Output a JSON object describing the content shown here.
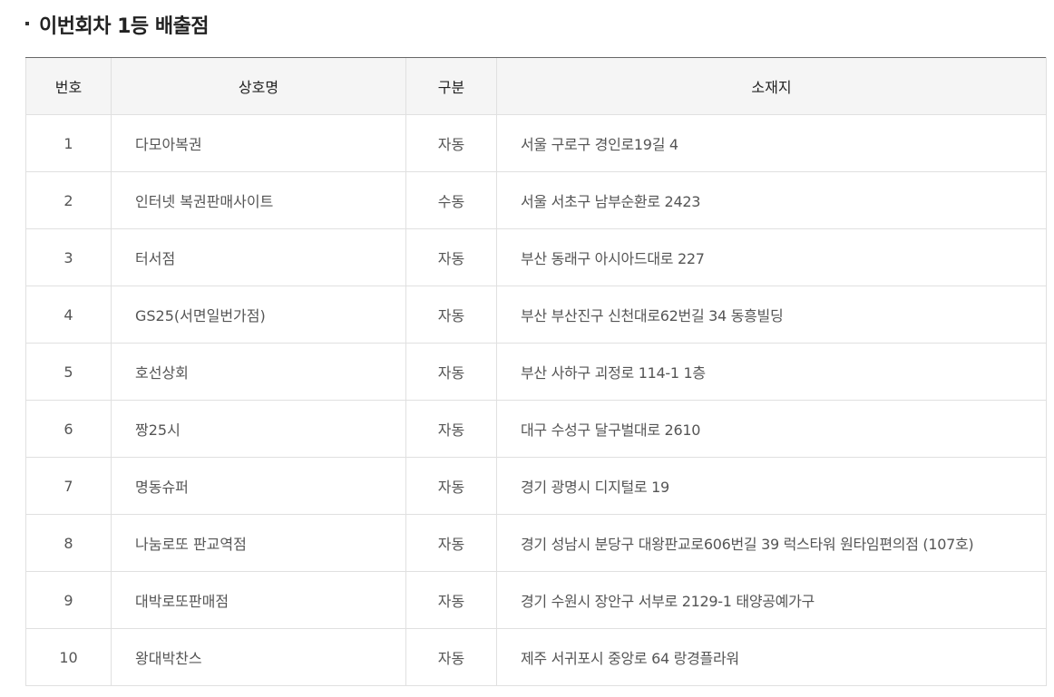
{
  "section": {
    "title": "이번회차 1등 배출점"
  },
  "table": {
    "headers": {
      "no": "번호",
      "name": "상호명",
      "type": "구분",
      "address": "소재지"
    },
    "rows": [
      {
        "no": "1",
        "name": "다모아복권",
        "type": "자동",
        "address": "서울 구로구 경인로19길 4"
      },
      {
        "no": "2",
        "name": "인터넷 복권판매사이트",
        "type": "수동",
        "address": "서울 서초구 남부순환로 2423"
      },
      {
        "no": "3",
        "name": "터서점",
        "type": "자동",
        "address": "부산 동래구 아시아드대로 227"
      },
      {
        "no": "4",
        "name": "GS25(서면일번가점)",
        "type": "자동",
        "address": "부산 부산진구 신천대로62번길 34 동흥빌딩"
      },
      {
        "no": "5",
        "name": "호선상회",
        "type": "자동",
        "address": "부산 사하구 괴정로 114-1 1층"
      },
      {
        "no": "6",
        "name": "짱25시",
        "type": "자동",
        "address": "대구 수성구 달구벌대로 2610"
      },
      {
        "no": "7",
        "name": "명동슈퍼",
        "type": "자동",
        "address": "경기 광명시 디지털로 19"
      },
      {
        "no": "8",
        "name": "나눔로또 판교역점",
        "type": "자동",
        "address": "경기 성남시 분당구 대왕판교로606번길 39 럭스타워 원타임편의점 (107호)"
      },
      {
        "no": "9",
        "name": "대박로또판매점",
        "type": "자동",
        "address": "경기 수원시 장안구 서부로 2129-1 태양공예가구"
      },
      {
        "no": "10",
        "name": "왕대박찬스",
        "type": "자동",
        "address": "제주 서귀포시 중앙로 64 랑경플라워"
      }
    ]
  }
}
